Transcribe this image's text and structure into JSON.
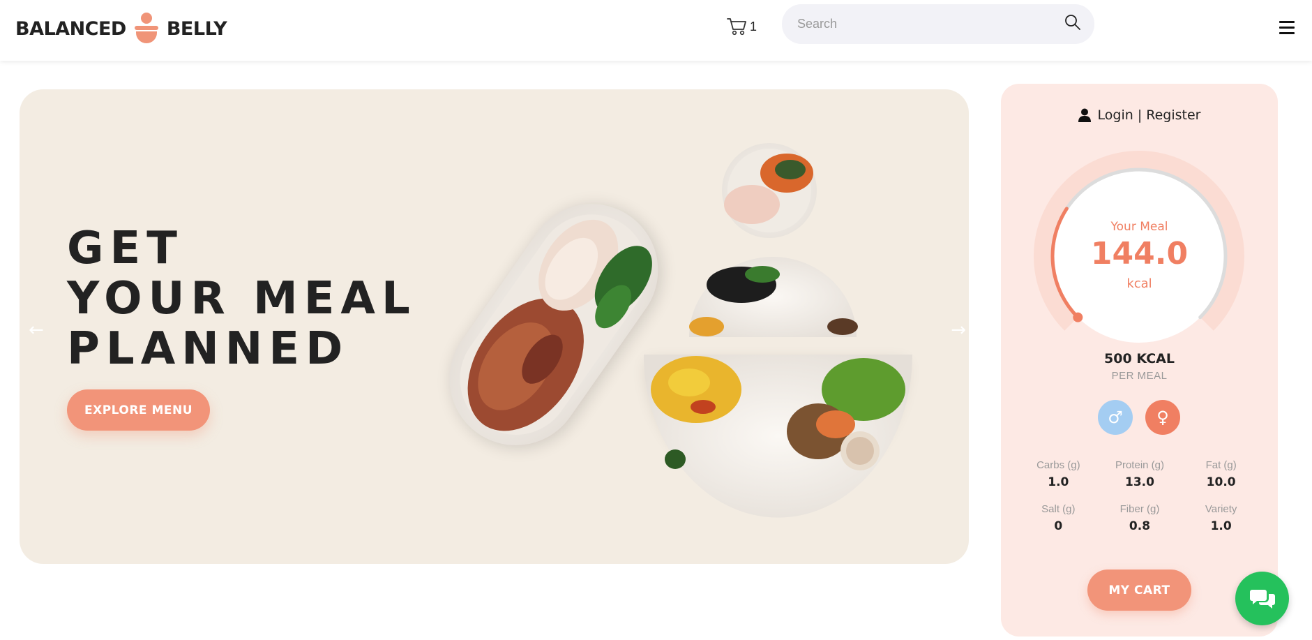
{
  "header": {
    "logo_left": "BALANCED",
    "logo_right": "BELLY",
    "cart_count": "1",
    "search_placeholder": "Search"
  },
  "hero": {
    "title_lines": [
      "GET",
      "YOUR MEAL",
      "PLANNED"
    ],
    "cta_label": "EXPLORE MENU",
    "prev_arrow": "←",
    "next_arrow": "→"
  },
  "panel": {
    "login_label": "Login | Register",
    "gauge": {
      "label": "Your Meal",
      "value": "144.0",
      "unit": "kcal",
      "fill_fraction": 0.29
    },
    "target": "500 KCAL",
    "target_sub": "PER MEAL",
    "male_symbol": "♂",
    "female_symbol": "♀",
    "nutrients": [
      {
        "label": "Carbs (g)",
        "value": "1.0"
      },
      {
        "label": "Protein (g)",
        "value": "13.0"
      },
      {
        "label": "Fat (g)",
        "value": "10.0"
      },
      {
        "label": "Salt (g)",
        "value": "0"
      },
      {
        "label": "Fiber (g)",
        "value": "0.8"
      },
      {
        "label": "Variety",
        "value": "1.0"
      }
    ],
    "cart_label": "MY CART"
  },
  "colors": {
    "accent": "#f29479",
    "accent_dark": "#f07f62",
    "panel_bg": "#fde9e4",
    "hero_bg": "#f3ece2",
    "male": "#a4cdf2",
    "chat": "#25c15c"
  }
}
